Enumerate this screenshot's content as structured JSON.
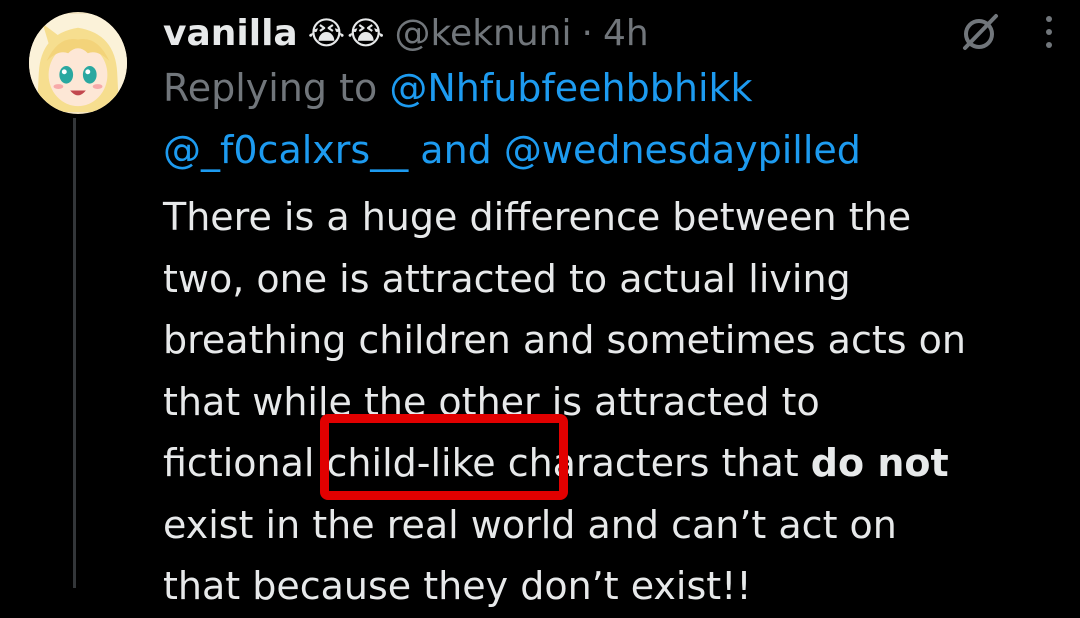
{
  "tweet": {
    "display_name": "vanilla",
    "name_emojis": [
      "😭",
      "😭"
    ],
    "handle": "@keknuni",
    "separator": "·",
    "time": "4h",
    "reply_prefix": "Replying to",
    "mentions": {
      "first": "@Nhfubfeehbbhikk",
      "second": "@_f0calxrs__",
      "conjunction": "and",
      "third": "@wednesdaypilled"
    },
    "body": {
      "line1": "There is a huge difference between the",
      "line2": "two, one is attracted to actual living",
      "line3": "breathing children and sometimes acts on",
      "line4": "that while the other is attracted to",
      "line5_a": "fictional child-like characters that ",
      "line5_bold": "do not",
      "line6": "exist in the real world and can’t act on",
      "line7": "that because they don’t exist!!"
    }
  },
  "icons": {
    "grok": "grok-icon",
    "more": "more-icon"
  },
  "colors": {
    "background": "#000000",
    "text": "#e7e9ea",
    "muted": "#71767b",
    "link": "#1d9bf0",
    "annotation": "#e10000"
  }
}
